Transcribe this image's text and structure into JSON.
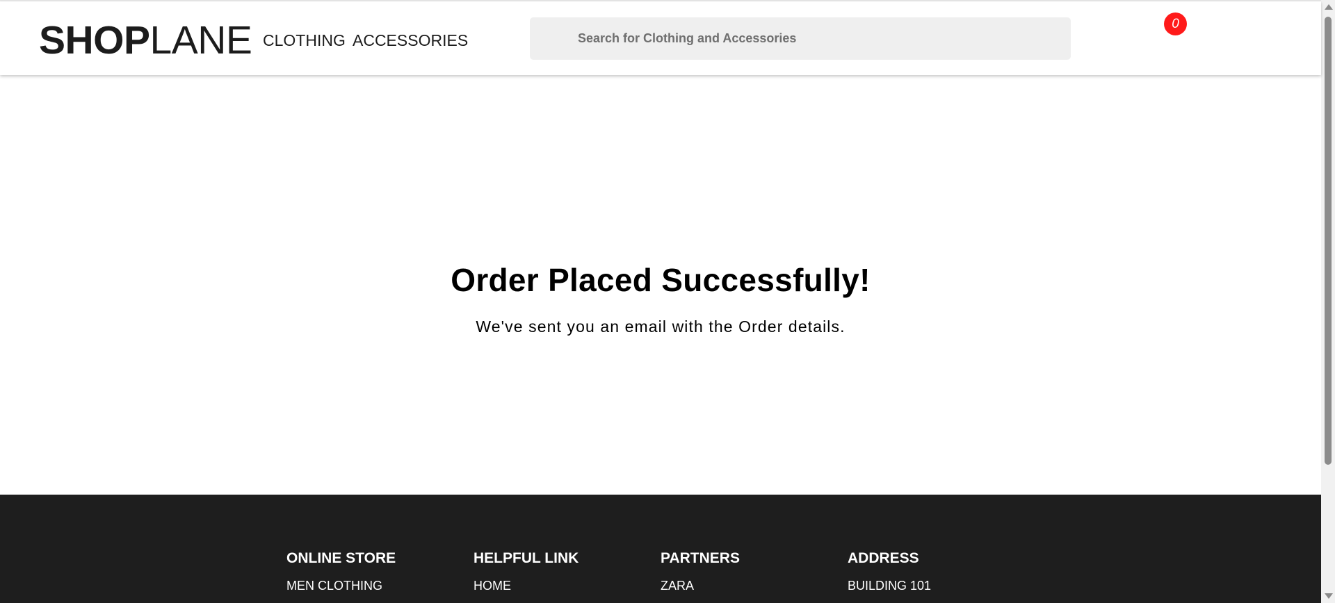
{
  "header": {
    "logo_bold": "SHOP",
    "logo_light": "LANE",
    "nav": {
      "clothing": "CLOTHING",
      "accessories": "ACCESSORIES"
    },
    "search": {
      "placeholder": "Search for Clothing and Accessories",
      "value": ""
    },
    "cart": {
      "count": "0",
      "icon": "shopping-cart-icon",
      "badge_color": "#ff1a1a"
    }
  },
  "main": {
    "title": "Order Placed Successfully!",
    "subtitle": "We've sent you an email with the Order details."
  },
  "footer": {
    "background": "#1e1e1e",
    "columns": [
      {
        "heading": "ONLINE STORE",
        "first_link": "MEN CLOTHING"
      },
      {
        "heading": "HELPFUL LINK",
        "first_link": "HOME"
      },
      {
        "heading": "PARTNERS",
        "first_link": "ZARA"
      },
      {
        "heading": "ADDRESS",
        "first_link": "BUILDING 101"
      }
    ]
  }
}
